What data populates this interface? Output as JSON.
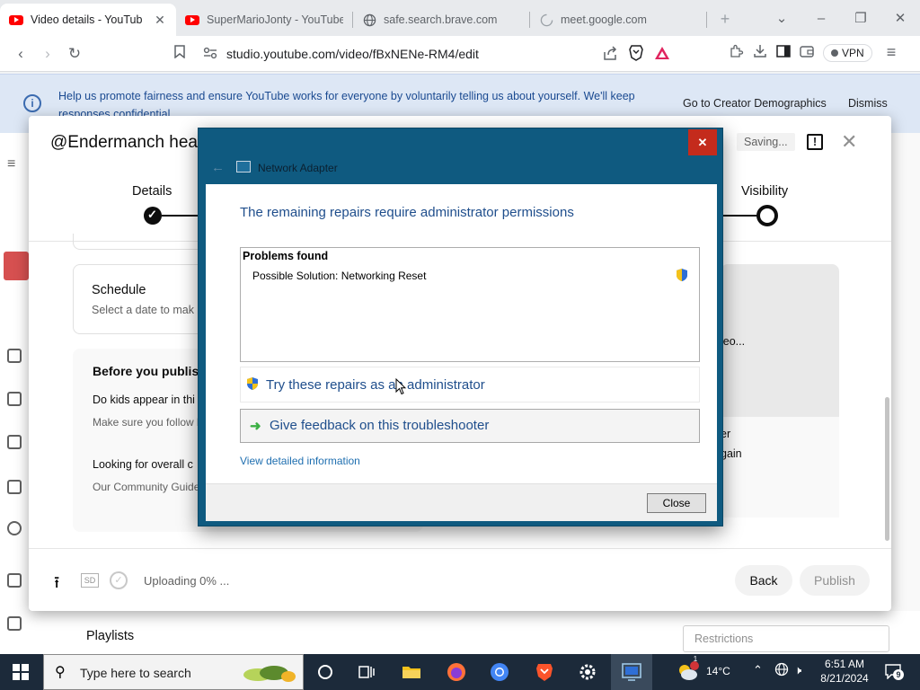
{
  "browser": {
    "tabs": [
      {
        "title": "Video details - YouTub",
        "active": true,
        "favicon": "youtube-icon"
      },
      {
        "title": "SuperMarioJonty - YouTube",
        "active": false,
        "favicon": "youtube-icon"
      },
      {
        "title": "safe.search.brave.com",
        "active": false,
        "favicon": "globe-icon"
      },
      {
        "title": "meet.google.com",
        "active": false,
        "favicon": "loading-icon"
      }
    ],
    "url": "studio.youtube.com/video/fBxNENe-RM4/edit",
    "vpn_label": "VPN"
  },
  "banner": {
    "text": "Help us promote fairness and ensure YouTube works for everyone by voluntarily telling us about yourself. We'll keep responses confidential.",
    "demographics_button": "Go to Creator Demographics",
    "dismiss_button": "Dismiss"
  },
  "modal": {
    "title": "@Endermanch hea",
    "saving": "Saving...",
    "steps": {
      "details": "Details",
      "visibility": "Visibility"
    },
    "schedule": {
      "heading": "Schedule",
      "sub": "Select a date to mak"
    },
    "before": {
      "heading": "Before you publis",
      "q1": "Do kids appear in thi",
      "q1_desc": "Make sure you follow bullying, and violation",
      "q2": "Looking for overall c",
      "q2_desc": "Our Community Guide YouTube remains a sa"
    },
    "video": {
      "processing": "leo...",
      "line1": "er",
      "line2": "gain"
    },
    "footer": {
      "sd_badge": "SD",
      "uploading": "Uploading 0% ...",
      "back": "Back",
      "publish": "Publish"
    }
  },
  "below": {
    "playlists": "Playlists",
    "restrictions": "Restrictions"
  },
  "troubleshooter": {
    "title": "Network Adapter",
    "close_x": "✕",
    "heading": "The remaining repairs require administrator permissions",
    "problems_header": "Problems found",
    "problem_item": "Possible Solution: Networking Reset",
    "option_admin": "Try these repairs as an administrator",
    "option_feedback": "Give feedback on this troubleshooter",
    "detail_link": "View detailed information",
    "close_button": "Close"
  },
  "taskbar": {
    "search_placeholder": "Type here to search",
    "temperature": "14°C",
    "time": "6:51 AM",
    "date": "8/21/2024",
    "notification_count": "9",
    "weather_badge": "1"
  }
}
